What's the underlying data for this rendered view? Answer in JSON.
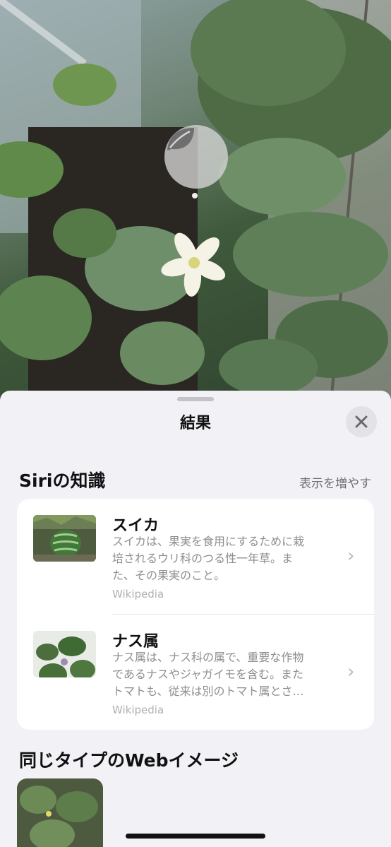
{
  "sheet": {
    "title": "結果",
    "close_icon": "close-icon"
  },
  "siri_knowledge": {
    "heading": "Siriの知識",
    "more_label": "表示を増やす",
    "items": [
      {
        "title": "スイカ",
        "description": "スイカは、果実を食用にするために栽\n培されるウリ科のつる性一年草。ま\nた、その果実のこと。",
        "source": "Wikipedia"
      },
      {
        "title": "ナス属",
        "description": "ナス属は、ナス科の属で、重要な作物\nであるナスやジャガイモを含む。また\nトマトも、従来は別のトマト属とさ…",
        "source": "Wikipedia"
      }
    ]
  },
  "web_images": {
    "heading": "同じタイプのWebイメージ"
  }
}
